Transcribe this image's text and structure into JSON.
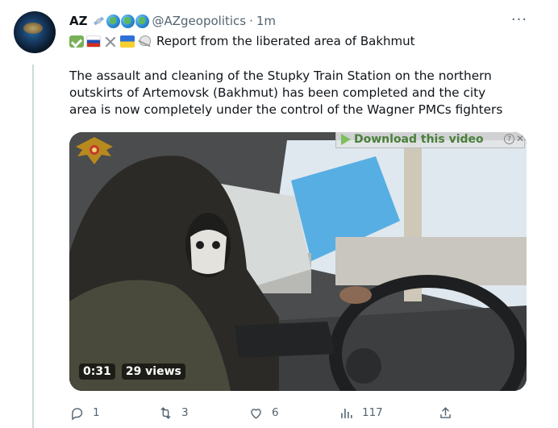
{
  "tweet": {
    "display_name": "AZ",
    "handle": "@AZgeopolitics",
    "separator": "·",
    "time": "1m",
    "line1": "Report from the liberated area of Bakhmut",
    "body": "The assault and cleaning of the Stupky Train Station on the northern outskirts of Artemovsk (Bakhmut) has been completed and the city area is now completely under the control of the Wagner PMCs fighters",
    "more_icon": "more-horizontal-icon",
    "name_emojis": [
      "satellite-icon",
      "globe-icon",
      "globe-icon",
      "globe-icon"
    ],
    "line1_emojis": [
      "check-mark-icon",
      "russia-flag-icon",
      "crossed-swords-icon",
      "ukraine-flag-icon",
      "skull-crossbones-icon"
    ]
  },
  "video": {
    "overlay_label": "Download this video",
    "duration": "0:31",
    "views": "29 views"
  },
  "actions": {
    "reply_count": "1",
    "retweet_count": "3",
    "like_count": "6",
    "views_count": "117"
  },
  "colors": {
    "secondary_text": "#536471",
    "thread_line": "#cfd9de"
  }
}
